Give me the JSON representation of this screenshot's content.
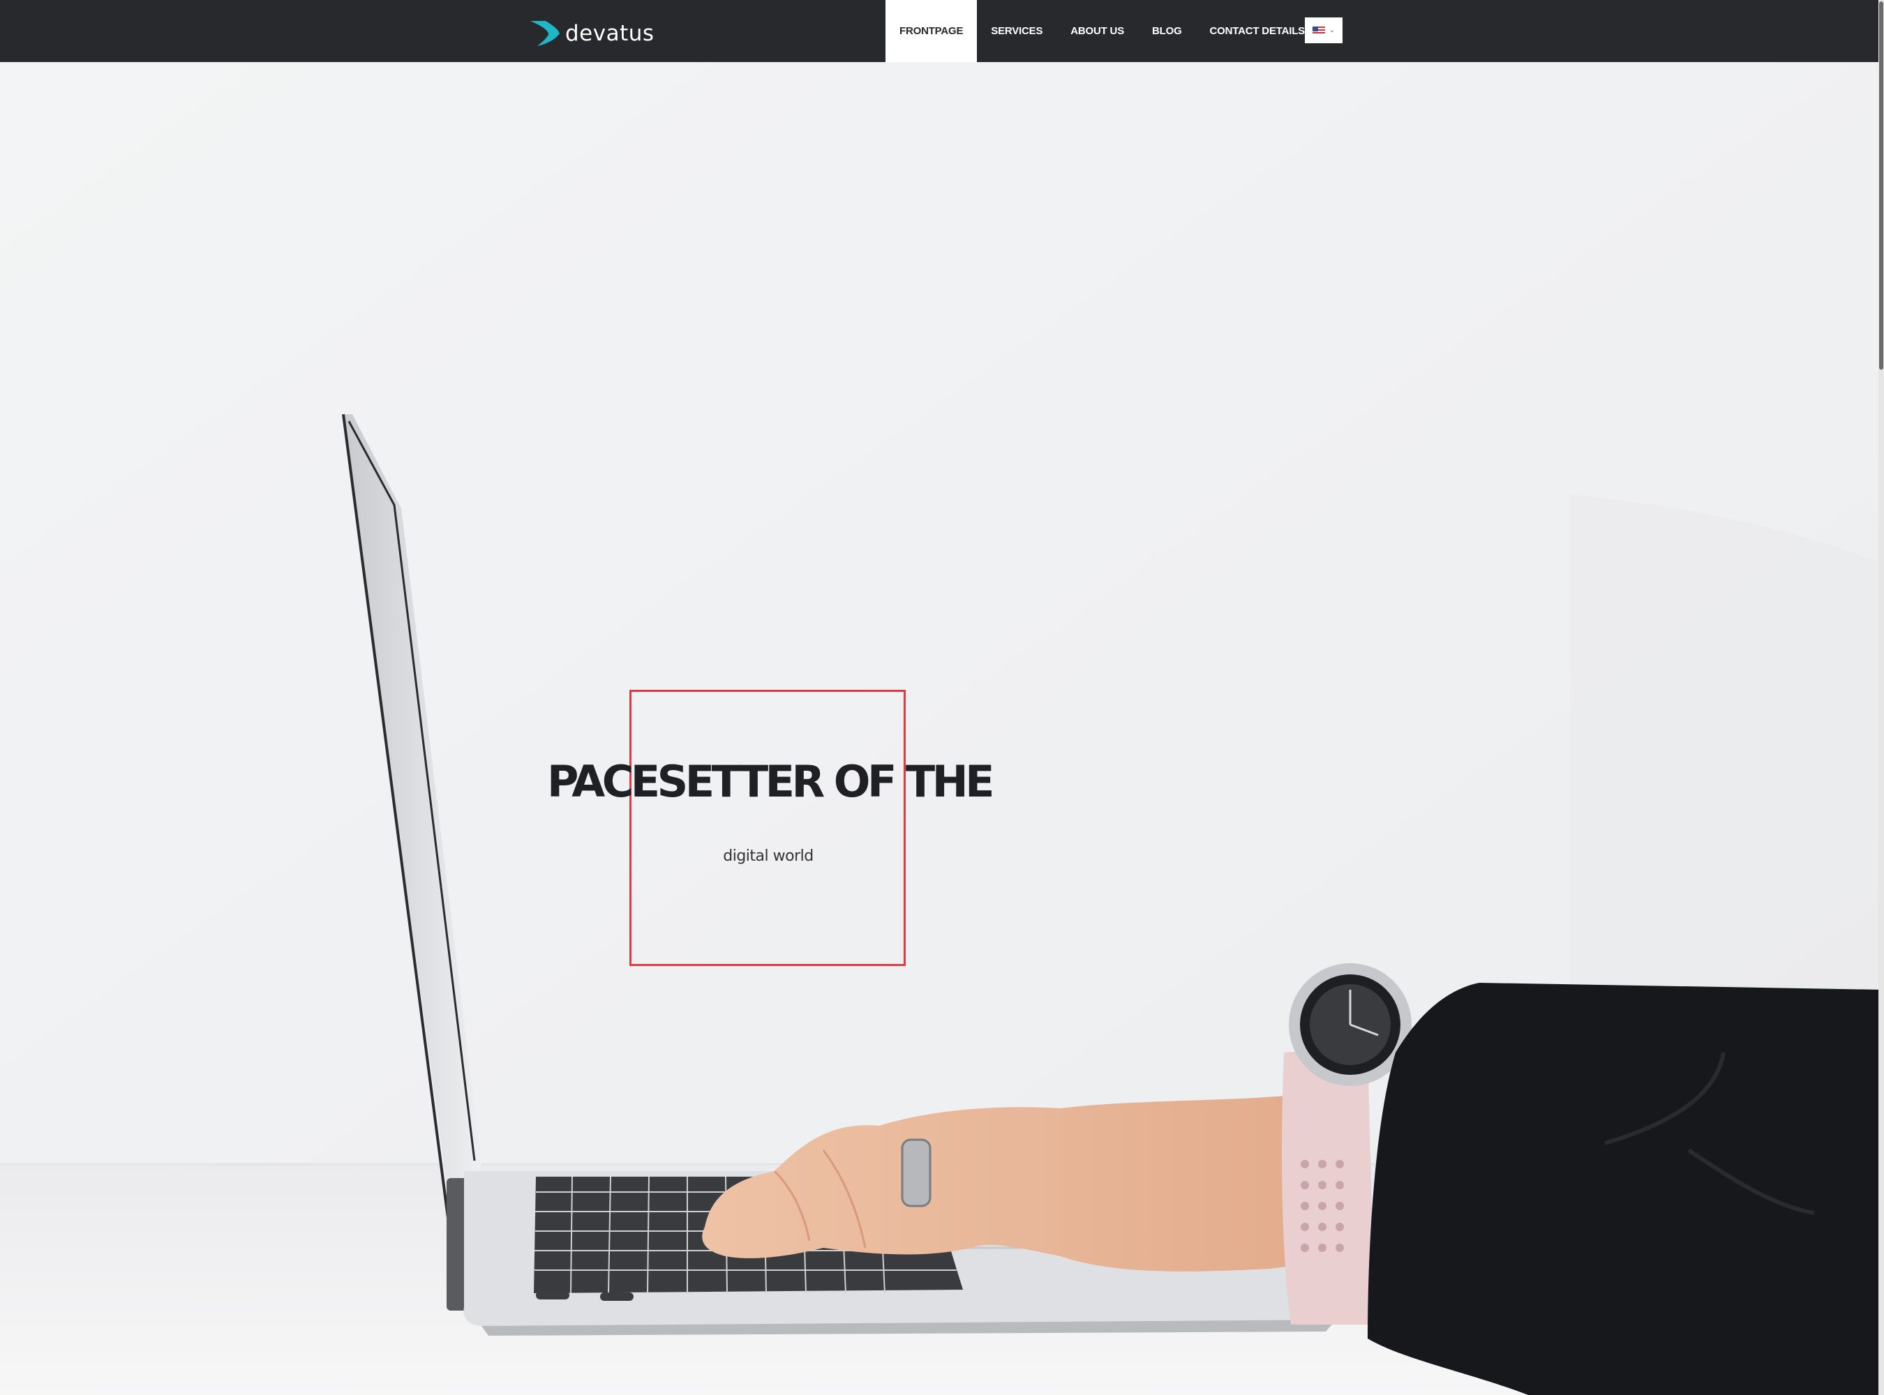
{
  "brand": {
    "name": "devatus",
    "accent": "#1fb6c6"
  },
  "nav": {
    "items": [
      {
        "label": "FRONTPAGE",
        "active": true
      },
      {
        "label": "SERVICES",
        "active": false
      },
      {
        "label": "ABOUT US",
        "active": false
      },
      {
        "label": "BLOG",
        "active": false
      },
      {
        "label": "CONTACT DETAILS",
        "active": false
      }
    ],
    "language": {
      "icon": "us-flag-icon",
      "chevron": "chevron-down-icon"
    }
  },
  "hero": {
    "headline": "PACESETTER OF THE",
    "subline": "digital world",
    "frame_color": "#e03a45"
  },
  "colors": {
    "header_bg": "#27292c",
    "page_bg": "#f1f2f3"
  }
}
